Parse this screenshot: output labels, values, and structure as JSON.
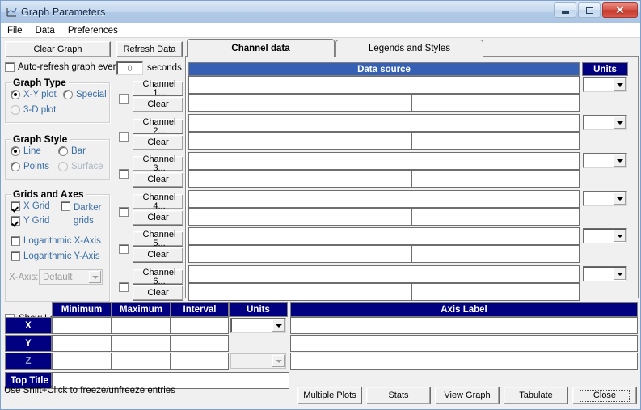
{
  "window": {
    "title": "Graph Parameters",
    "icon": "graph-icon",
    "minimize_label": "Minimize",
    "maximize_label": "Maximize",
    "close_label": "Close"
  },
  "menubar": {
    "items": [
      {
        "label": "File"
      },
      {
        "label": "Data"
      },
      {
        "label": "Preferences"
      }
    ]
  },
  "toolbar": {
    "clear_graph": "Clear Graph",
    "refresh_data": "Refresh Data",
    "auto_refresh_label": "Auto-refresh graph every",
    "auto_refresh_checked": false,
    "seconds_value": "0",
    "seconds_label": "seconds"
  },
  "graph_type": {
    "title": "Graph Type",
    "options": [
      {
        "label": "X-Y plot",
        "selected": true,
        "enabled": true
      },
      {
        "label": "Special",
        "selected": false,
        "enabled": true
      },
      {
        "label": "3-D plot",
        "selected": false,
        "enabled": false
      }
    ]
  },
  "graph_style": {
    "title": "Graph Style",
    "options": [
      {
        "label": "Line",
        "selected": true,
        "enabled": true
      },
      {
        "label": "Bar",
        "selected": false,
        "enabled": true
      },
      {
        "label": "Points",
        "selected": false,
        "enabled": true
      },
      {
        "label": "Surface",
        "selected": false,
        "enabled": false
      }
    ]
  },
  "grids_and_axes": {
    "title": "Grids and Axes",
    "checkboxes": [
      {
        "label": "X Grid",
        "checked": true,
        "enabled": true
      },
      {
        "label": "Darker",
        "label2": "grids",
        "checked": false,
        "enabled": true
      },
      {
        "label": "Y Grid",
        "checked": true,
        "enabled": true
      },
      {
        "label": "Logarithmic X-Axis",
        "checked": false,
        "enabled": true
      },
      {
        "label": "Logarithmic Y-Axis",
        "checked": false,
        "enabled": true
      }
    ],
    "xaxis_label": "X-Axis:",
    "xaxis_value": "Default",
    "xaxis_enabled": false
  },
  "show_legend": {
    "label": "Show Legend",
    "checked": false
  },
  "tabs": [
    {
      "label": "Channel data",
      "active": true
    },
    {
      "label": "Legends and Styles",
      "active": false
    }
  ],
  "channel_grid": {
    "headers": {
      "data_source": "Data source",
      "units": "Units"
    },
    "rows": [
      {
        "name": "Channel 1...",
        "clear": "Clear",
        "enabled": false,
        "source": "",
        "sub_left": "",
        "sub_right": "",
        "units": ""
      },
      {
        "name": "Channel 2...",
        "clear": "Clear",
        "enabled": false,
        "source": "",
        "sub_left": "",
        "sub_right": "",
        "units": ""
      },
      {
        "name": "Channel 3...",
        "clear": "Clear",
        "enabled": false,
        "source": "",
        "sub_left": "",
        "sub_right": "",
        "units": ""
      },
      {
        "name": "Channel 4...",
        "clear": "Clear",
        "enabled": false,
        "source": "",
        "sub_left": "",
        "sub_right": "",
        "units": ""
      },
      {
        "name": "Channel 5...",
        "clear": "Clear",
        "enabled": false,
        "source": "",
        "sub_left": "",
        "sub_right": "",
        "units": ""
      },
      {
        "name": "Channel 6...",
        "clear": "Clear",
        "enabled": false,
        "source": "",
        "sub_left": "",
        "sub_right": "",
        "units": ""
      }
    ]
  },
  "axis_grid": {
    "headers": [
      "Minimum",
      "Maximum",
      "Interval",
      "Units",
      "Axis Label"
    ],
    "rows": [
      {
        "axis": "X",
        "enabled": true,
        "minimum": "",
        "maximum": "",
        "interval": "",
        "units": "",
        "units_enabled": true,
        "axis_label": ""
      },
      {
        "axis": "Y",
        "enabled": true,
        "minimum": "",
        "maximum": "",
        "interval": "",
        "units": "",
        "units_enabled": false,
        "axis_label": ""
      },
      {
        "axis": "Z",
        "enabled": false,
        "minimum": "",
        "maximum": "",
        "interval": "",
        "units": "",
        "units_enabled": false,
        "axis_label": ""
      }
    ],
    "top_title_label": "Top Title",
    "top_title_value": ""
  },
  "status": {
    "hint": "Use Shift+Click to freeze/unfreeze entries"
  },
  "footer_buttons": [
    {
      "label": "Multiple Plots",
      "accel": "",
      "default": false
    },
    {
      "label": "Stats",
      "accel": "S",
      "default": false
    },
    {
      "label": "View Graph",
      "accel": "V",
      "default": false
    },
    {
      "label": "Tabulate",
      "accel": "T",
      "default": false
    },
    {
      "label": "Close",
      "accel": "C",
      "default": true
    }
  ],
  "colors": {
    "header_blue": "#3560b4",
    "header_navy": "#000080",
    "label_blue": "#3a6ea5",
    "face": "#f0f0f0",
    "titlebar": "#b0c9e6"
  }
}
